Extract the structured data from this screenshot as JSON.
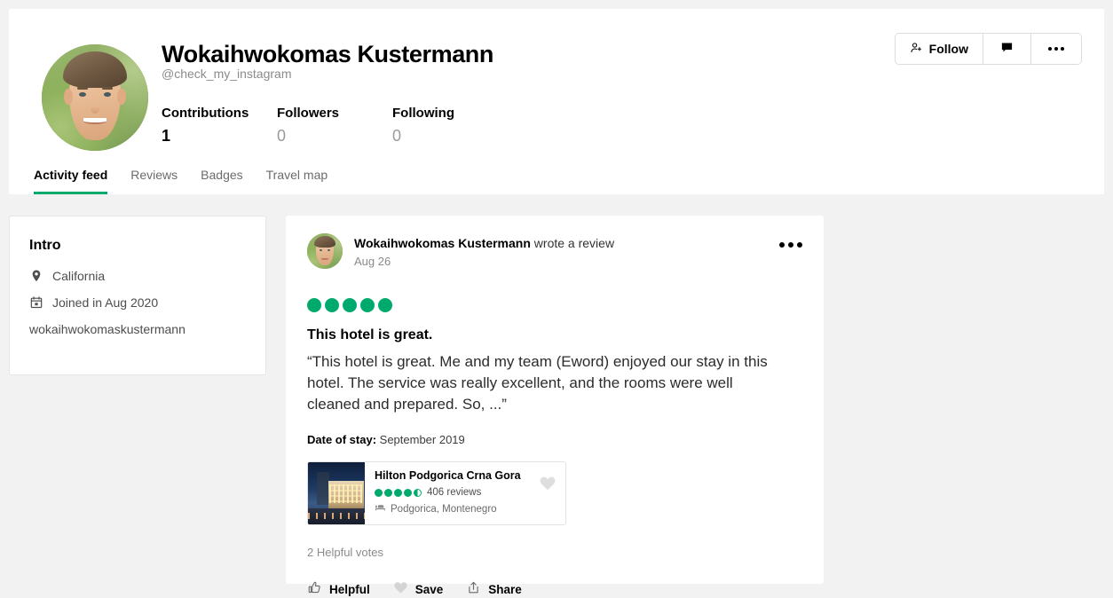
{
  "profile": {
    "name": "Wokaihwokomas Kustermann",
    "handle": "@check_my_instagram",
    "avatar_icon": "user-avatar-photo",
    "stats": [
      {
        "label": "Contributions",
        "value": "1",
        "is_zero": false
      },
      {
        "label": "Followers",
        "value": "0",
        "is_zero": true
      },
      {
        "label": "Following",
        "value": "0",
        "is_zero": true
      }
    ],
    "actions": {
      "follow_label": "Follow",
      "follow_icon": "person-add-icon",
      "message_icon": "chat-bubble-icon",
      "more_icon": "more-horizontal-icon"
    },
    "tabs": [
      {
        "label": "Activity feed",
        "active": true
      },
      {
        "label": "Reviews",
        "active": false
      },
      {
        "label": "Badges",
        "active": false
      },
      {
        "label": "Travel map",
        "active": false
      }
    ]
  },
  "intro": {
    "title": "Intro",
    "location": "California",
    "location_icon": "map-pin-icon",
    "joined": "Joined in Aug 2020",
    "joined_icon": "calendar-icon",
    "username": "wokaihwokomaskustermann"
  },
  "review": {
    "author": "Wokaihwokomas Kustermann",
    "action_text": " wrote a review",
    "date": "Aug 26",
    "menu_icon": "more-horizontal-icon",
    "rating": 5,
    "rating_max": 5,
    "title": "This hotel is great.",
    "body": "“This hotel is great. Me and my team (Eword) enjoyed our stay in this hotel. The service was really excellent, and the rooms were well cleaned and prepared. So, ...”",
    "date_of_stay_label": "Date of stay:",
    "date_of_stay_value": " September 2019",
    "helpful_votes": "2 Helpful votes",
    "actions": [
      {
        "label": "Helpful",
        "icon": "thumbs-up-icon"
      },
      {
        "label": "Save",
        "icon": "heart-icon"
      },
      {
        "label": "Share",
        "icon": "share-icon"
      }
    ]
  },
  "hotel": {
    "name": "Hilton Podgorica Crna Gora",
    "rating": 4.5,
    "reviews_count": "406 reviews",
    "location": "Podgorica, Montenegro",
    "location_icon": "bed-icon",
    "save_icon": "heart-icon",
    "thumbnail_icon": "hotel-photo"
  },
  "colors": {
    "accent_green": "#00aa6c",
    "page_background": "#f2f2f2",
    "card_background": "#ffffff",
    "muted_text": "#8b8b8b"
  }
}
